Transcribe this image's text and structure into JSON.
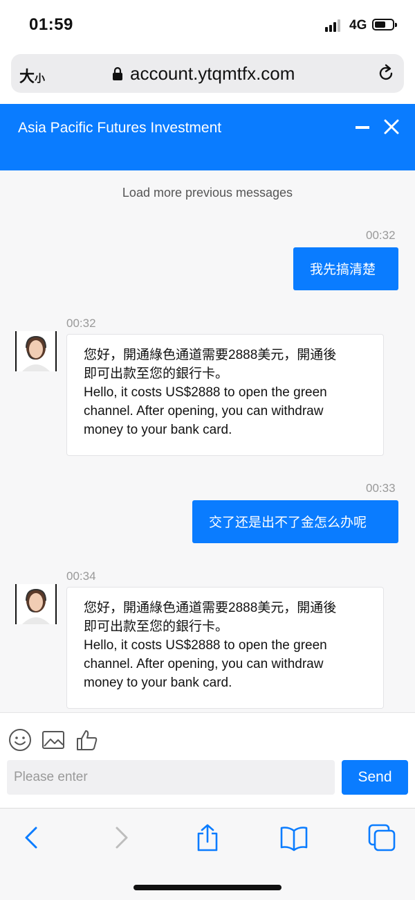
{
  "status_bar": {
    "time": "01:59",
    "network": "4G",
    "icons": [
      "signal-icon",
      "battery-icon"
    ]
  },
  "browser": {
    "text_size_label": "大",
    "text_size_small": "小",
    "url": "account.ytqmtfx.com",
    "icons": [
      "lock-icon",
      "reload-icon"
    ]
  },
  "chat": {
    "title": "Asia Pacific Futures Investment",
    "header_icons": [
      "minimize-icon",
      "close-icon"
    ],
    "load_more": "Load more previous messages",
    "messages": [
      {
        "direction": "out",
        "time": "00:32",
        "text": "我先搞清楚"
      },
      {
        "direction": "in",
        "time": "00:32",
        "lines": [
          "您好，開通綠色通道需要2888美元，開通後",
          "即可出款至您的銀行卡。",
          "Hello, it costs US$2888 to open the green",
          "channel. After opening, you can withdraw",
          "money to your bank card."
        ]
      },
      {
        "direction": "out",
        "time": "00:33",
        "text": "交了还是出不了金怎么办呢"
      },
      {
        "direction": "in",
        "time": "00:34",
        "lines": [
          "您好，開通綠色通道需要2888美元，開通後",
          "即可出款至您的銀行卡。",
          "Hello, it costs US$2888 to open the green",
          "channel. After opening, you can withdraw",
          "money to your bank card."
        ]
      }
    ]
  },
  "composer": {
    "tools": [
      "smiley-icon",
      "image-icon",
      "thumbs-up-icon"
    ],
    "placeholder": "Please enter",
    "value": "",
    "send_label": "Send"
  },
  "toolbar": {
    "icons": [
      "back-icon",
      "forward-icon",
      "share-icon",
      "bookmarks-icon",
      "tabs-icon"
    ]
  },
  "colors": {
    "accent": "#0a7cff",
    "chat_bg": "#f7f7f8",
    "timestamp": "#999999"
  }
}
